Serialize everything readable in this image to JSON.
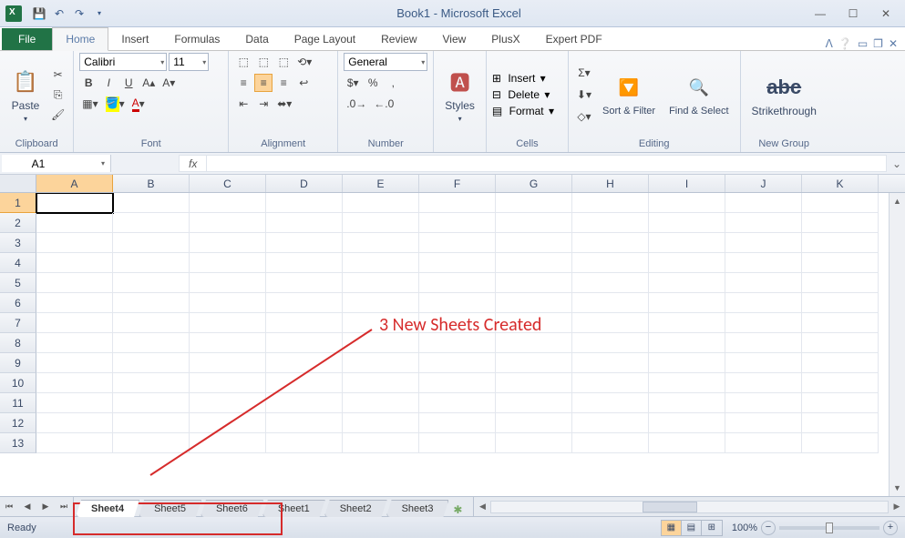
{
  "title": "Book1 - Microsoft Excel",
  "ribbon_tabs": {
    "file": "File",
    "home": "Home",
    "insert": "Insert",
    "formulas": "Formulas",
    "data": "Data",
    "page_layout": "Page Layout",
    "review": "Review",
    "view": "View",
    "plusx": "PlusX",
    "expert_pdf": "Expert PDF"
  },
  "groups": {
    "clipboard": "Clipboard",
    "font": "Font",
    "alignment": "Alignment",
    "number": "Number",
    "styles": "Styles",
    "cells": "Cells",
    "editing": "Editing",
    "newgroup": "New Group"
  },
  "clipboard": {
    "paste": "Paste"
  },
  "font": {
    "name": "Calibri",
    "size": "11",
    "bold": "B",
    "italic": "I",
    "underline": "U"
  },
  "number": {
    "format": "General"
  },
  "cells": {
    "insert": "Insert",
    "delete": "Delete",
    "format": "Format"
  },
  "editing": {
    "sort": "Sort & Filter",
    "find": "Find & Select"
  },
  "newgroup": {
    "strike": "Strikethrough"
  },
  "namebox": "A1",
  "columns": [
    "A",
    "B",
    "C",
    "D",
    "E",
    "F",
    "G",
    "H",
    "I",
    "J",
    "K"
  ],
  "rows": [
    "1",
    "2",
    "3",
    "4",
    "5",
    "6",
    "7",
    "8",
    "9",
    "10",
    "11",
    "12",
    "13"
  ],
  "annotation": "3 New Sheets Created",
  "sheets": [
    "Sheet4",
    "Sheet5",
    "Sheet6",
    "Sheet1",
    "Sheet2",
    "Sheet3"
  ],
  "status": {
    "ready": "Ready",
    "zoom": "100%"
  }
}
